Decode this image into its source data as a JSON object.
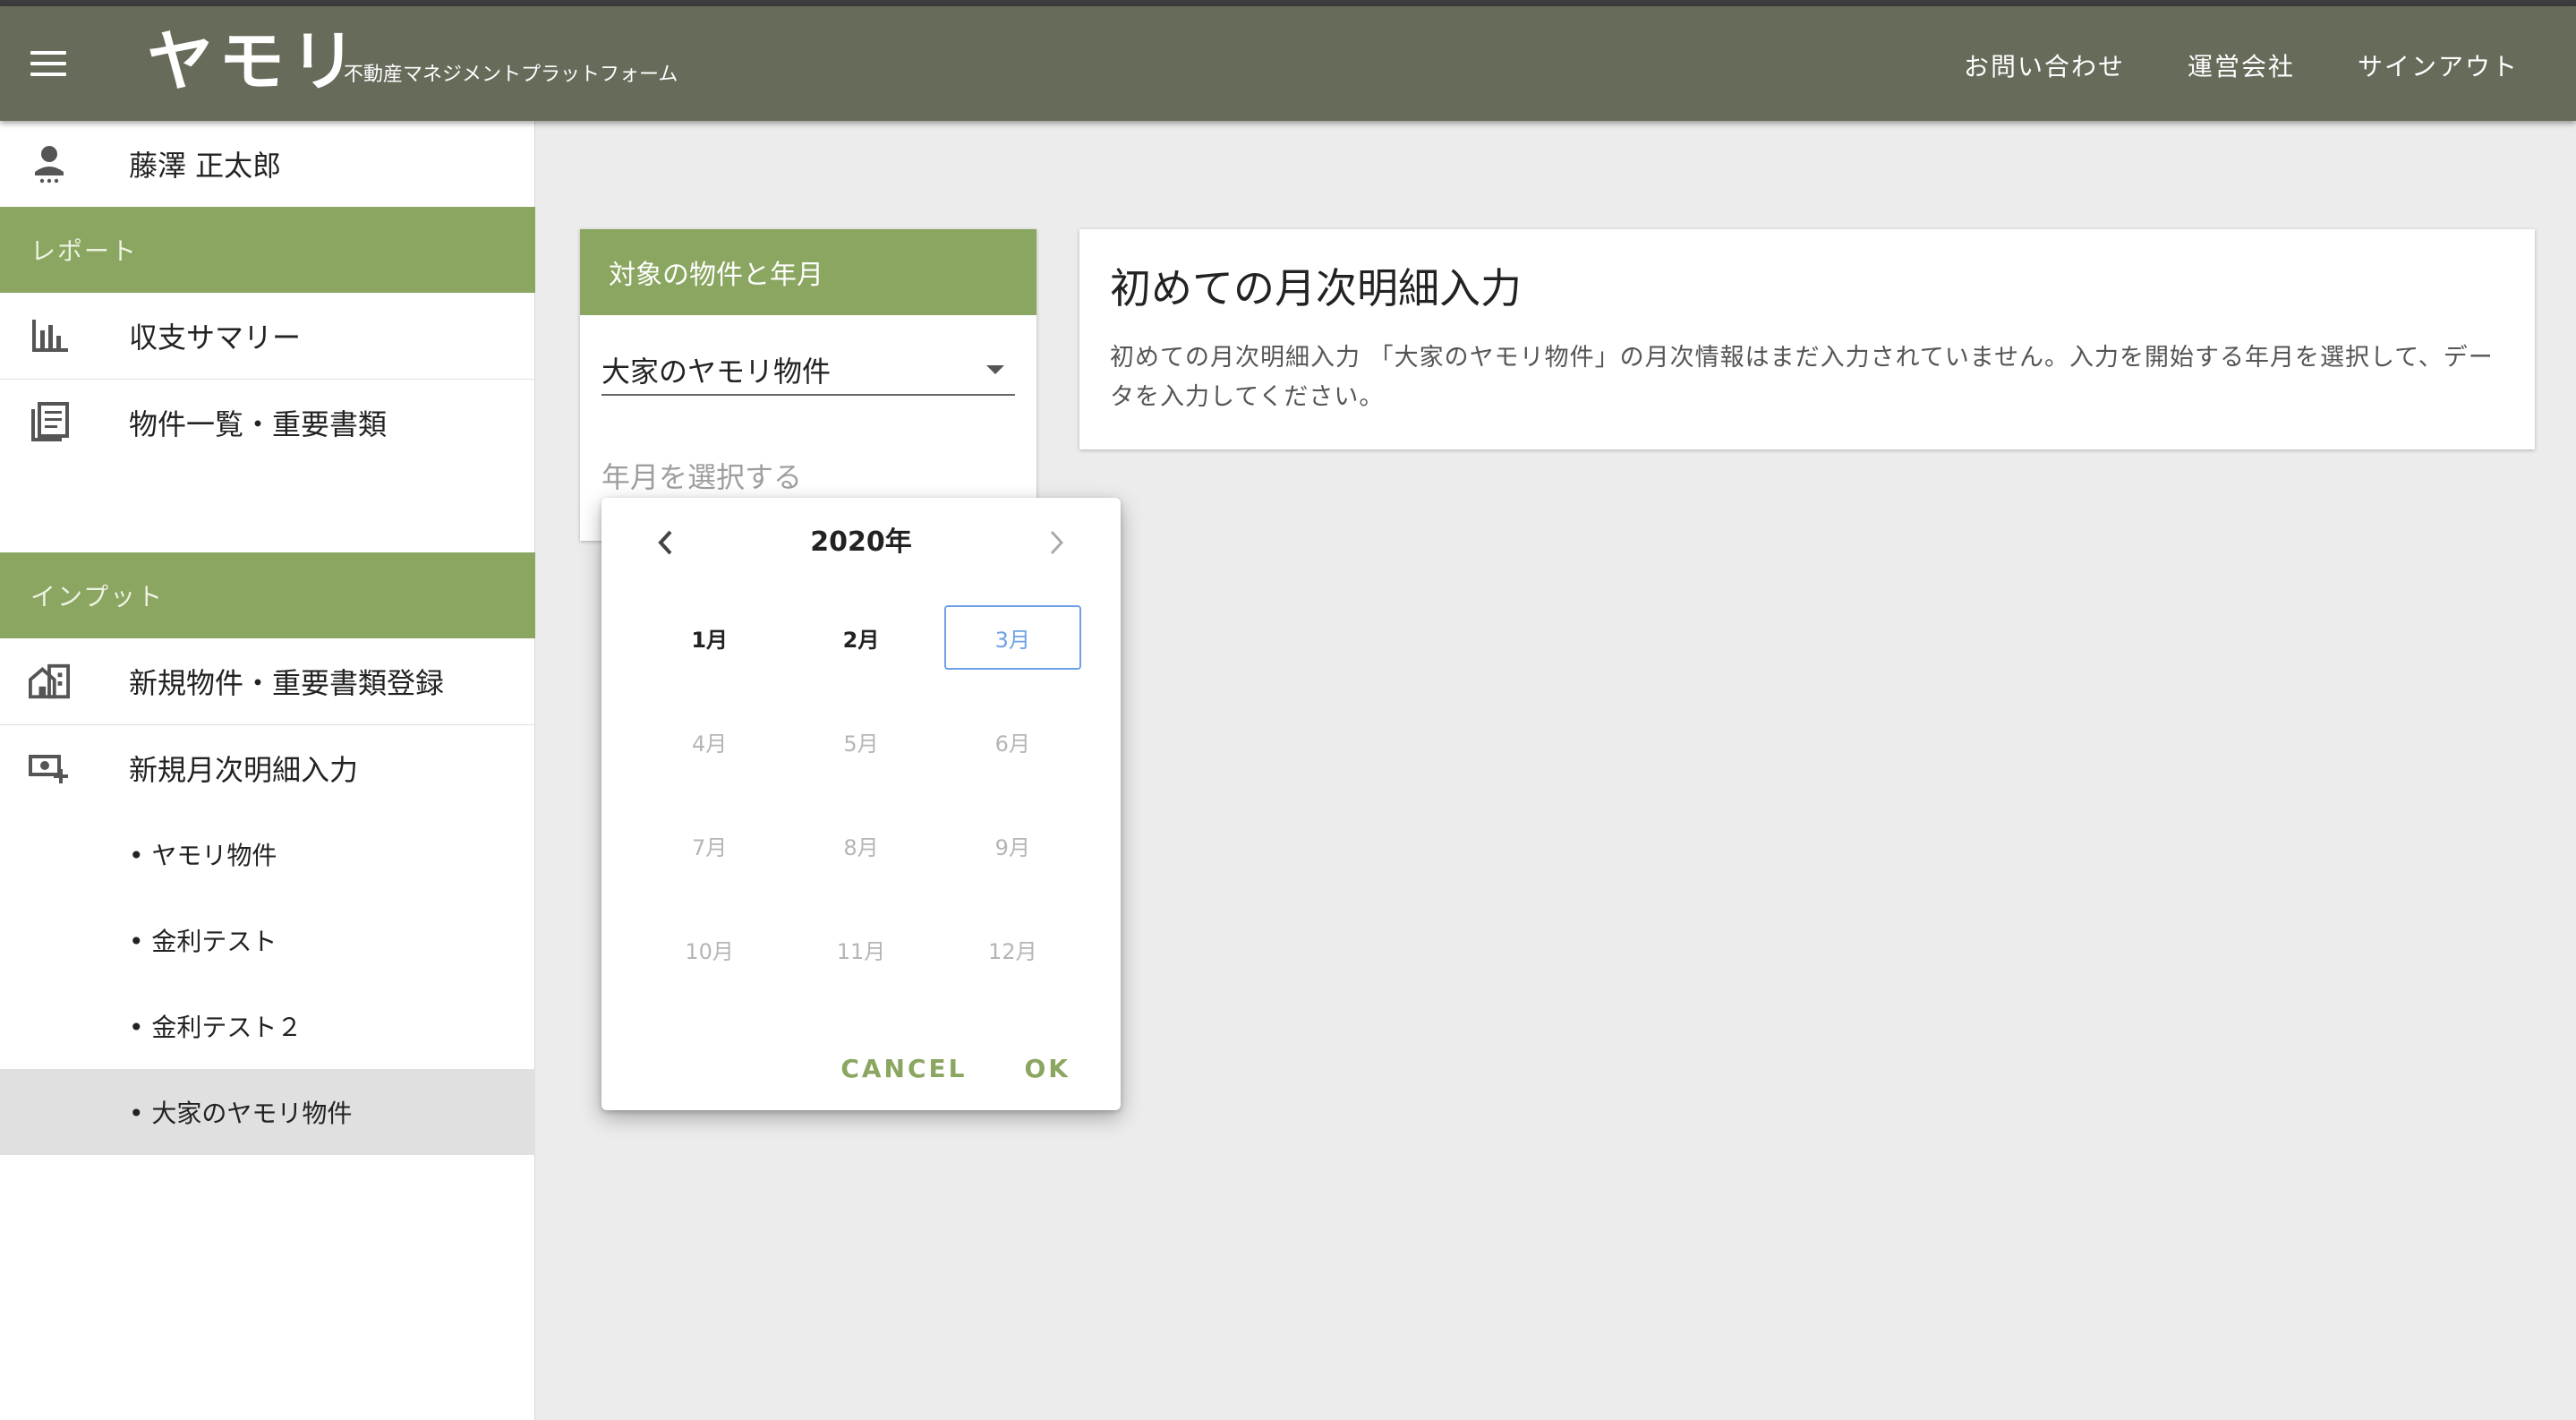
{
  "header": {
    "logo": "ヤモリ",
    "tagline": "不動産マネジメントプラットフォーム",
    "nav": [
      "お問い合わせ",
      "運営会社",
      "サインアウト"
    ]
  },
  "sidebar": {
    "user_name": "藤澤 正太郎",
    "section_report": "レポート",
    "report_items": [
      "収支サマリー",
      "物件一覧・重要書類"
    ],
    "section_input": "インプット",
    "input_items": [
      "新規物件・重要書類登録",
      "新規月次明細入力"
    ],
    "sub_items": [
      "• ヤモリ物件",
      "• 金利テスト",
      "• 金利テスト２",
      "• 大家のヤモリ物件"
    ],
    "active_sub_item": "• 大家のヤモリ物件"
  },
  "target_card": {
    "title": "対象の物件と年月",
    "property_value": "大家のヤモリ物件",
    "date_placeholder": "年月を選択する"
  },
  "info_card": {
    "title": "初めての月次明細入力",
    "description": "初めての月次明細入力 「大家のヤモリ物件」の月次情報はまだ入力されていません。入力を開始する年月を選択して、データを入力してください。"
  },
  "month_picker": {
    "year": "2020年",
    "months": [
      "1月",
      "2月",
      "3月",
      "4月",
      "5月",
      "6月",
      "7月",
      "8月",
      "9月",
      "10月",
      "11月",
      "12月"
    ],
    "enabled_months": [
      "1月",
      "2月",
      "3月"
    ],
    "selected_month": "3月",
    "cancel_label": "CANCEL",
    "ok_label": "OK"
  },
  "colors": {
    "appbar": "#666b5a",
    "accent_green": "#8aa660",
    "selected_blue": "#6ea0e8"
  },
  "icons": [
    "menu-icon",
    "person-icon",
    "bar-chart-icon",
    "document-list-icon",
    "building-add-icon",
    "money-add-icon",
    "chevron-left-icon",
    "chevron-right-icon",
    "dropdown-arrow-icon"
  ]
}
